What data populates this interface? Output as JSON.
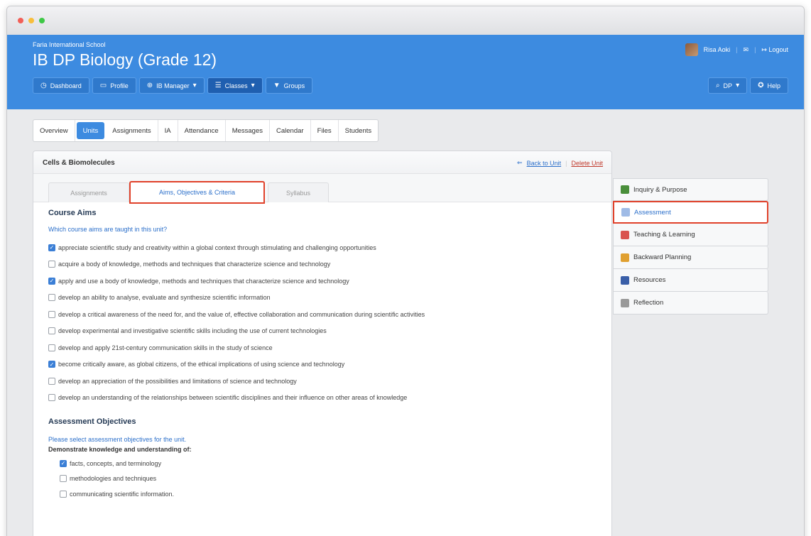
{
  "window": {
    "dot_colors": [
      "#f25f57",
      "#f8be3b",
      "#3ec846"
    ]
  },
  "header": {
    "school": "Faria International School",
    "course_title": "IB DP Biology (Grade 12)",
    "nav": [
      {
        "label": "Dashboard",
        "icon": "dashboard-icon"
      },
      {
        "label": "Profile",
        "icon": "profile-card-icon"
      },
      {
        "label": "IB Manager",
        "icon": "globe-icon"
      },
      {
        "label": "Classes",
        "icon": "classes-icon"
      },
      {
        "label": "Groups",
        "icon": "groups-icon"
      }
    ],
    "user_name": "Risa Aoki",
    "logout_label": "Logout",
    "search_label": "DP",
    "help_label": "Help"
  },
  "tabs": [
    "Overview",
    "Units",
    "Assignments",
    "IA",
    "Attendance",
    "Messages",
    "Calendar",
    "Files",
    "Students"
  ],
  "unit": {
    "title": "Cells & Biomolecules",
    "back_label": "Back to Unit",
    "delete_label": "Delete Unit",
    "subtabs": [
      "Assignments",
      "Aims, Objectives & Criteria",
      "Syllabus"
    ]
  },
  "course_aims": {
    "heading": "Course Aims",
    "question": "Which course aims are taught in this unit?",
    "items": [
      {
        "text": "appreciate scientific study and creativity within a global context through stimulating and challenging opportunities",
        "checked": true
      },
      {
        "text": "acquire a body of knowledge, methods and techniques that characterize science and technology",
        "checked": false
      },
      {
        "text": "apply and use a body of knowledge, methods and techniques that characterize science and technology",
        "checked": true
      },
      {
        "text": "develop an ability to analyse, evaluate and synthesize scientific information",
        "checked": false
      },
      {
        "text": "develop a critical awareness of the need for, and the value of, effective collaboration and communication during scientific activities",
        "checked": false
      },
      {
        "text": "develop experimental and investigative scientific skills including the use of current technologies",
        "checked": false
      },
      {
        "text": "develop and apply 21st-century communication skills in the study of science",
        "checked": false
      },
      {
        "text": "become critically aware, as global citizens, of the ethical implications of using science and technology",
        "checked": true
      },
      {
        "text": "develop an appreciation of the possibilities and limitations of science and technology",
        "checked": false
      },
      {
        "text": "develop an understanding of the relationships between scientific disciplines and their influence on other areas of knowledge",
        "checked": false
      }
    ]
  },
  "assessment_objectives": {
    "heading": "Assessment Objectives",
    "prompt": "Please select assessment objectives for the unit.",
    "group_label": "Demonstrate knowledge and understanding of:",
    "items": [
      {
        "text": "facts, concepts, and terminology",
        "checked": true
      },
      {
        "text": "methodologies and techniques",
        "checked": false
      },
      {
        "text": "communicating scientific information.",
        "checked": false
      }
    ]
  },
  "side_menu": [
    {
      "label": "Inquiry & Purpose",
      "icon": "inquiry-icon",
      "color": "#4a8f3b"
    },
    {
      "label": "Assessment",
      "icon": "assessment-doc-icon",
      "color": "#9fbbe6"
    },
    {
      "label": "Teaching & Learning",
      "icon": "teaching-icon",
      "color": "#d9534f"
    },
    {
      "label": "Backward Planning",
      "icon": "planning-icon",
      "color": "#e0a030"
    },
    {
      "label": "Resources",
      "icon": "resources-icon",
      "color": "#3a5fa8"
    },
    {
      "label": "Reflection",
      "icon": "reflection-icon",
      "color": "#999999"
    }
  ]
}
